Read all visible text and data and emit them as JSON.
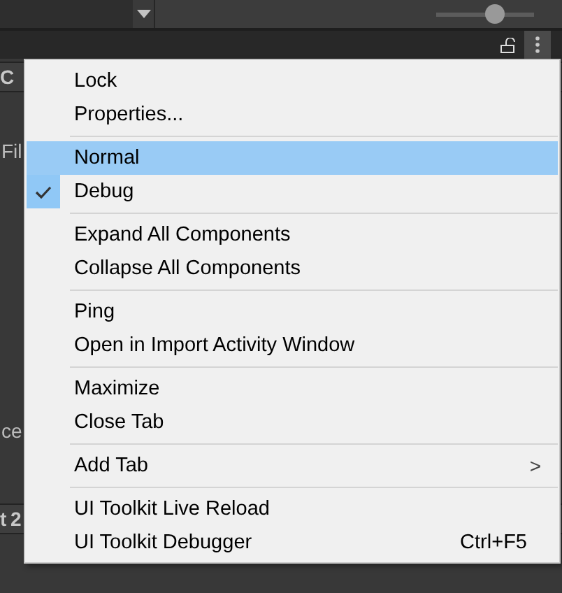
{
  "toolbar": {
    "slider": {
      "level": 0.6
    }
  },
  "tab_bar": {
    "locked": false
  },
  "inspector": {
    "labels": [
      {
        "text": "C",
        "kind": "header"
      },
      {
        "text": "Fil",
        "kind": "label"
      },
      {
        "text": "ce",
        "kind": "label"
      },
      {
        "text": "t 2",
        "kind": "header"
      }
    ]
  },
  "menu": {
    "sections": [
      [
        {
          "label": "Lock",
          "checked": false,
          "highlighted": false
        },
        {
          "label": "Properties...",
          "checked": false,
          "highlighted": false
        }
      ],
      [
        {
          "label": "Normal",
          "checked": false,
          "highlighted": true
        },
        {
          "label": "Debug",
          "checked": true,
          "highlighted": false
        }
      ],
      [
        {
          "label": "Expand All Components",
          "checked": false,
          "highlighted": false
        },
        {
          "label": "Collapse All Components",
          "checked": false,
          "highlighted": false
        }
      ],
      [
        {
          "label": "Ping",
          "checked": false,
          "highlighted": false
        },
        {
          "label": "Open in Import Activity Window",
          "checked": false,
          "highlighted": false
        }
      ],
      [
        {
          "label": "Maximize",
          "checked": false,
          "highlighted": false
        },
        {
          "label": "Close Tab",
          "checked": false,
          "highlighted": false
        }
      ],
      [
        {
          "label": "Add Tab",
          "checked": false,
          "highlighted": false,
          "submenu": ">"
        }
      ],
      [
        {
          "label": "UI Toolkit Live Reload",
          "checked": false,
          "highlighted": false
        },
        {
          "label": "UI Toolkit Debugger",
          "checked": false,
          "highlighted": false,
          "shortcut": "Ctrl+F5"
        }
      ]
    ]
  }
}
